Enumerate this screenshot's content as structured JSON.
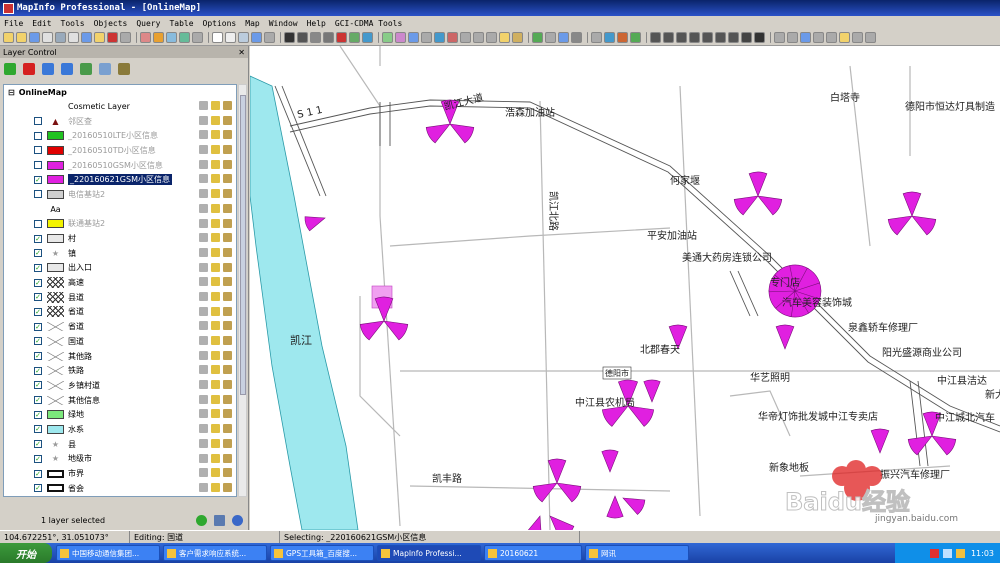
{
  "window": {
    "title": "MapInfo Professional - [OnlineMap]"
  },
  "menu": [
    "File",
    "Edit",
    "Tools",
    "Objects",
    "Query",
    "Table",
    "Options",
    "Map",
    "Window",
    "Help",
    "GCI-CDMA Tools"
  ],
  "layer_control": {
    "title": "Layer Control",
    "root": "OnlineMap",
    "layers": [
      {
        "name": "Cosmetic Layer",
        "checked": null,
        "swatch": "none",
        "grey": false
      },
      {
        "name": "邻区查",
        "checked": false,
        "swatch": "triangle",
        "grey": true
      },
      {
        "name": "_20160510LTE小区信息",
        "checked": false,
        "swatch": "#21c321",
        "grey": true
      },
      {
        "name": "_20160510TD小区信息",
        "checked": false,
        "swatch": "#e00000",
        "grey": true
      },
      {
        "name": "_20160510GSM小区信息",
        "checked": false,
        "swatch": "#e020e0",
        "grey": true
      },
      {
        "name": "_220160621GSM小区信息",
        "checked": true,
        "swatch": "#e020e0",
        "grey": false,
        "selected": true
      },
      {
        "name": "电信基站2",
        "checked": false,
        "swatch": "#cfcfcf",
        "grey": true
      },
      {
        "name": "",
        "checked": null,
        "swatch": "Aa",
        "grey": false
      },
      {
        "name": "联通基站2",
        "checked": false,
        "swatch": "#f3f300",
        "grey": true
      },
      {
        "name": "村",
        "checked": true,
        "swatch": "#e8e8e8",
        "grey": false
      },
      {
        "name": "镇",
        "checked": true,
        "swatch": "star",
        "grey": false
      },
      {
        "name": "出入口",
        "checked": true,
        "swatch": "#e8e8e8",
        "grey": false
      },
      {
        "name": "高速",
        "checked": true,
        "swatch": "xline",
        "grey": false
      },
      {
        "name": "县道",
        "checked": true,
        "swatch": "xline",
        "grey": false
      },
      {
        "name": "省道",
        "checked": true,
        "swatch": "xline",
        "grey": false
      },
      {
        "name": "省道",
        "checked": true,
        "swatch": "xthin",
        "grey": false
      },
      {
        "name": "国道",
        "checked": true,
        "swatch": "xthin",
        "grey": false
      },
      {
        "name": "其他路",
        "checked": true,
        "swatch": "xthin",
        "grey": false
      },
      {
        "name": "铁路",
        "checked": true,
        "swatch": "xthin",
        "grey": false
      },
      {
        "name": "乡镇村道",
        "checked": true,
        "swatch": "xthin",
        "grey": false
      },
      {
        "name": "其他信息",
        "checked": true,
        "swatch": "xthin",
        "grey": false
      },
      {
        "name": "绿地",
        "checked": true,
        "swatch": "#7ce87c",
        "grey": false
      },
      {
        "name": "水系",
        "checked": true,
        "swatch": "#9ee8ee",
        "grey": false
      },
      {
        "name": "县",
        "checked": true,
        "swatch": "star",
        "grey": false
      },
      {
        "name": "地级市",
        "checked": true,
        "swatch": "star",
        "grey": false
      },
      {
        "name": "市界",
        "checked": true,
        "swatch": "boxline",
        "grey": false
      },
      {
        "name": "省会",
        "checked": true,
        "swatch": "boxline",
        "grey": false
      },
      {
        "name": "县界",
        "checked": true,
        "swatch": "boxline",
        "grey": false
      }
    ],
    "status": "1 layer selected"
  },
  "map": {
    "labels": [
      "浩森加油站",
      "白塔寺",
      "德阳市恒达灯具制造",
      "何家堰",
      "凯江北路",
      "平安加油站",
      "美通大药房连锁公司",
      "专门店",
      "汽车美容装饰城",
      "泉鑫轿车修理厂",
      "凯江",
      "北郡春天",
      "阳光盛源商业公司",
      "德阳市",
      "华艺照明",
      "中江县洁达",
      "新大",
      "中江县农机局",
      "华帝灯饰批发城中江专卖店",
      "中江城北汽车",
      "凯丰路",
      "新象地板",
      "振兴汽车修理厂",
      "S 1 1",
      "凯江大道"
    ],
    "colors": {
      "water": "#9ee8ee",
      "road": "#b8b8b8",
      "sector": "#e020e0"
    }
  },
  "status_bar": {
    "coords": "104.672251°, 31.051073°",
    "editing": "Editing:  国道",
    "selecting": "Selecting:  _220160621GSM小区信息"
  },
  "taskbar": {
    "start": "开始",
    "tasks": [
      "中国移动通信集团...",
      "客户需求响应系统...",
      "GPS工具箱_百度搜...",
      "MapInfo Professi...",
      "20160621",
      "网讯"
    ],
    "clock": "11:03"
  },
  "watermark": {
    "logo": "Baidu经验",
    "url": "jingyan.baidu.com"
  }
}
